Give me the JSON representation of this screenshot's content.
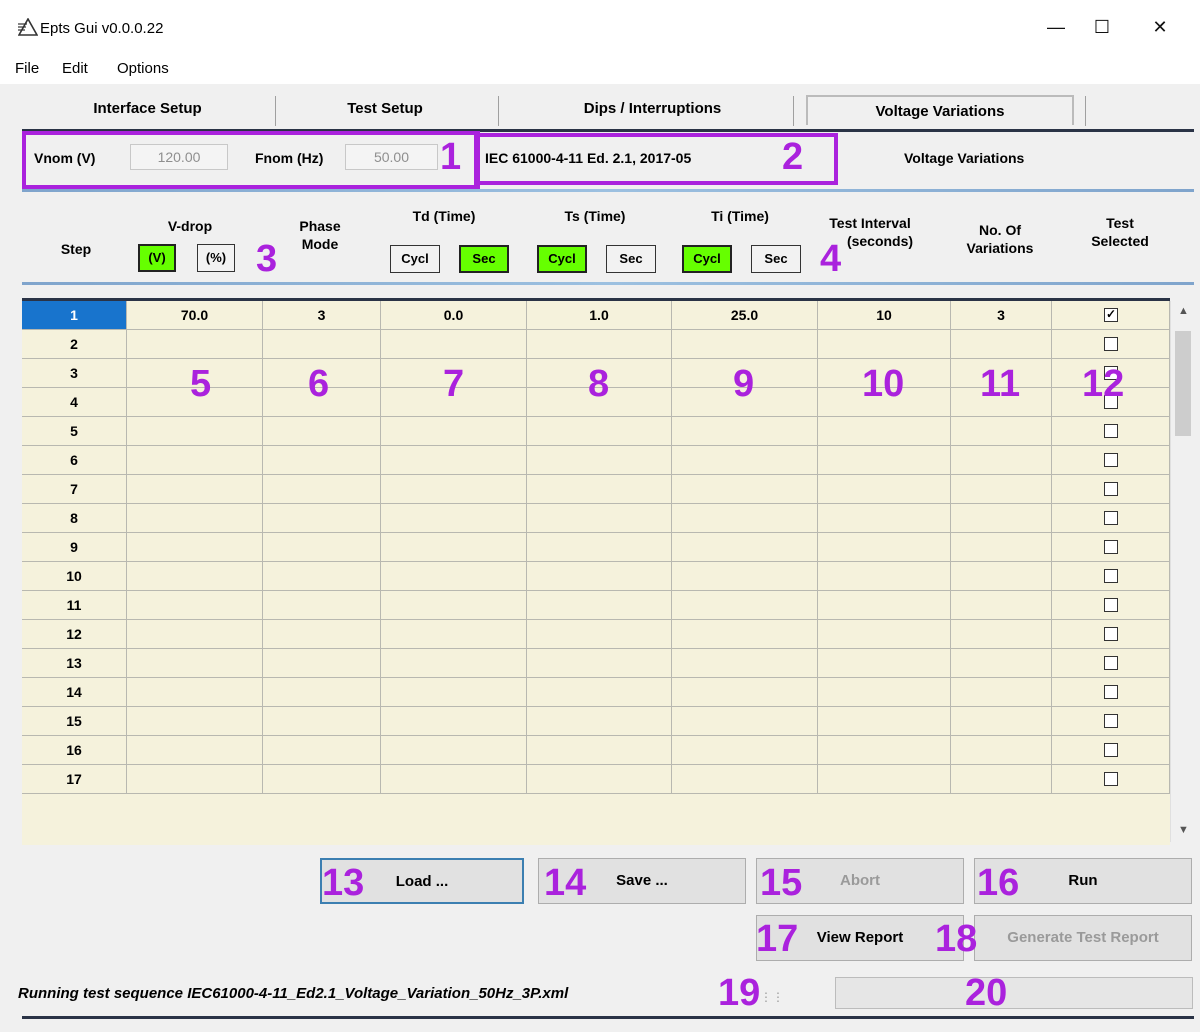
{
  "window": {
    "title": "Epts Gui v0.0.0.22",
    "minimize": "—",
    "maximize": "☐",
    "close": "✕"
  },
  "menu": [
    "File",
    "Edit",
    "Options"
  ],
  "tabs": [
    {
      "label": "Interface Setup",
      "active": false
    },
    {
      "label": "Test Setup",
      "active": false
    },
    {
      "label": "Dips / Interruptions",
      "active": false
    },
    {
      "label": "Voltage Variations",
      "active": true
    }
  ],
  "nominal": {
    "vnom_label": "Vnom (V)",
    "vnom_value": "120.00",
    "fnom_label": "Fnom (Hz)",
    "fnom_value": "50.00"
  },
  "standard": "IEC 61000-4-11 Ed. 2.1, 2017-05",
  "panel_title": "Voltage Variations",
  "columns": {
    "step": "Step",
    "vdrop": "V-drop",
    "vdrop_v": "(V)",
    "vdrop_pct": "(%)",
    "phase_mode_1": "Phase",
    "phase_mode_2": "Mode",
    "td": "Td (Time)",
    "ts": "Ts (Time)",
    "ti": "Ti (Time)",
    "cycl": "Cycl",
    "sec": "Sec",
    "interval_1": "Test Interval",
    "interval_2": "(seconds)",
    "variations_1": "No. Of",
    "variations_2": "Variations",
    "selected_1": "Test",
    "selected_2": "Selected"
  },
  "unit_toggles": {
    "vdrop": "V",
    "td": "Sec",
    "ts": "Cycl",
    "ti": "Cycl"
  },
  "rows": [
    {
      "step": "1",
      "vdrop": "70.0",
      "phase": "3",
      "td": "0.0",
      "ts": "1.0",
      "ti": "25.0",
      "interval": "10",
      "variations": "3",
      "selected": true
    },
    {
      "step": "2",
      "vdrop": "",
      "phase": "",
      "td": "",
      "ts": "",
      "ti": "",
      "interval": "",
      "variations": "",
      "selected": false
    },
    {
      "step": "3",
      "vdrop": "",
      "phase": "",
      "td": "",
      "ts": "",
      "ti": "",
      "interval": "",
      "variations": "",
      "selected": false
    },
    {
      "step": "4",
      "vdrop": "",
      "phase": "",
      "td": "",
      "ts": "",
      "ti": "",
      "interval": "",
      "variations": "",
      "selected": false
    },
    {
      "step": "5",
      "vdrop": "",
      "phase": "",
      "td": "",
      "ts": "",
      "ti": "",
      "interval": "",
      "variations": "",
      "selected": false
    },
    {
      "step": "6",
      "vdrop": "",
      "phase": "",
      "td": "",
      "ts": "",
      "ti": "",
      "interval": "",
      "variations": "",
      "selected": false
    },
    {
      "step": "7",
      "vdrop": "",
      "phase": "",
      "td": "",
      "ts": "",
      "ti": "",
      "interval": "",
      "variations": "",
      "selected": false
    },
    {
      "step": "8",
      "vdrop": "",
      "phase": "",
      "td": "",
      "ts": "",
      "ti": "",
      "interval": "",
      "variations": "",
      "selected": false
    },
    {
      "step": "9",
      "vdrop": "",
      "phase": "",
      "td": "",
      "ts": "",
      "ti": "",
      "interval": "",
      "variations": "",
      "selected": false
    },
    {
      "step": "10",
      "vdrop": "",
      "phase": "",
      "td": "",
      "ts": "",
      "ti": "",
      "interval": "",
      "variations": "",
      "selected": false
    },
    {
      "step": "11",
      "vdrop": "",
      "phase": "",
      "td": "",
      "ts": "",
      "ti": "",
      "interval": "",
      "variations": "",
      "selected": false
    },
    {
      "step": "12",
      "vdrop": "",
      "phase": "",
      "td": "",
      "ts": "",
      "ti": "",
      "interval": "",
      "variations": "",
      "selected": false
    },
    {
      "step": "13",
      "vdrop": "",
      "phase": "",
      "td": "",
      "ts": "",
      "ti": "",
      "interval": "",
      "variations": "",
      "selected": false
    },
    {
      "step": "14",
      "vdrop": "",
      "phase": "",
      "td": "",
      "ts": "",
      "ti": "",
      "interval": "",
      "variations": "",
      "selected": false
    },
    {
      "step": "15",
      "vdrop": "",
      "phase": "",
      "td": "",
      "ts": "",
      "ti": "",
      "interval": "",
      "variations": "",
      "selected": false
    },
    {
      "step": "16",
      "vdrop": "",
      "phase": "",
      "td": "",
      "ts": "",
      "ti": "",
      "interval": "",
      "variations": "",
      "selected": false
    },
    {
      "step": "17",
      "vdrop": "",
      "phase": "",
      "td": "",
      "ts": "",
      "ti": "",
      "interval": "",
      "variations": "",
      "selected": false
    }
  ],
  "buttons": {
    "load": "Load ...",
    "save": "Save ...",
    "abort": "Abort",
    "run": "Run",
    "view_report": "View Report",
    "generate_report": "Generate Test Report"
  },
  "status_text": "Running test sequence  IEC61000-4-11_Ed2.1_Voltage_Variation_50Hz_3P.xml",
  "annotations": [
    "1",
    "2",
    "3",
    "4",
    "5",
    "6",
    "7",
    "8",
    "9",
    "10",
    "11",
    "12",
    "13",
    "14",
    "15",
    "16",
    "17",
    "18",
    "19",
    "20"
  ],
  "colors": {
    "toggle_on": "#66ff00",
    "annotation": "#aa22dd",
    "grid_background": "#f5f2dc",
    "selected_step": "#1874cd"
  }
}
